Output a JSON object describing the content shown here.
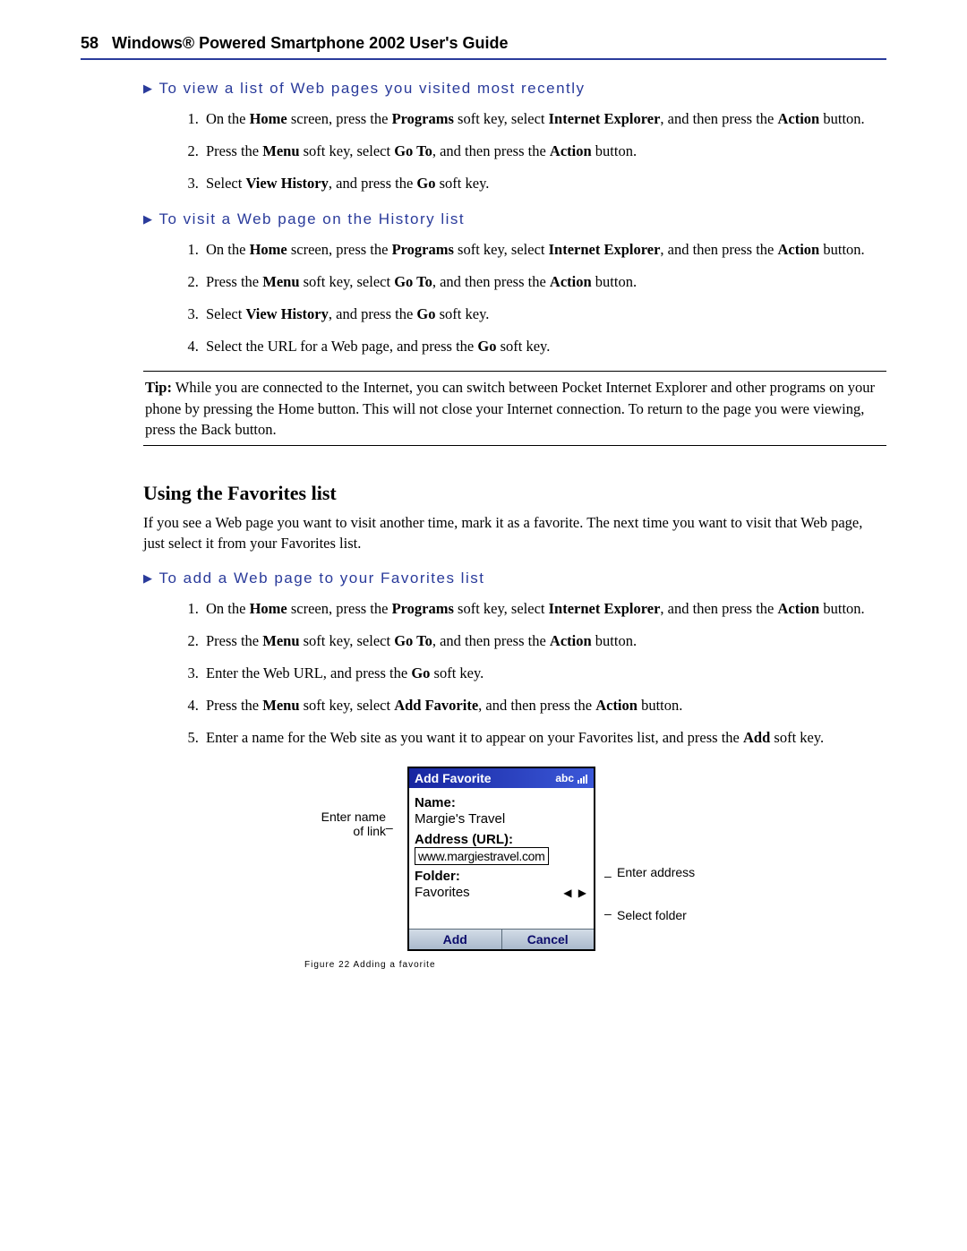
{
  "header": {
    "page_number": "58",
    "title": "Windows® Powered Smartphone 2002 User's Guide"
  },
  "section1": {
    "title": "To view a list of Web pages you visited most recently",
    "steps": {
      "s1a": "On the ",
      "s1b": "Home",
      "s1c": " screen, press the ",
      "s1d": "Programs",
      "s1e": " soft key, select ",
      "s1f": "Internet Explorer",
      "s1g": ", and then press the ",
      "s1h": "Action",
      "s1i": " button.",
      "s2a": "Press the ",
      "s2b": "Menu",
      "s2c": " soft key, select ",
      "s2d": "Go To",
      "s2e": ", and then press the ",
      "s2f": "Action",
      "s2g": " button.",
      "s3a": "Select ",
      "s3b": "View History",
      "s3c": ", and press the ",
      "s3d": "Go",
      "s3e": " soft key."
    }
  },
  "section2": {
    "title": "To visit a Web page on the History list",
    "steps": {
      "s1a": "On the ",
      "s1b": "Home",
      "s1c": " screen, press the ",
      "s1d": "Programs",
      "s1e": " soft key, select ",
      "s1f": "Internet Explorer",
      "s1g": ", and then press the ",
      "s1h": "Action",
      "s1i": " button.",
      "s2a": "Press the ",
      "s2b": "Menu",
      "s2c": " soft key, select ",
      "s2d": "Go To",
      "s2e": ", and then press the ",
      "s2f": "Action",
      "s2g": " button.",
      "s3a": "Select ",
      "s3b": "View History",
      "s3c": ", and press the ",
      "s3d": "Go",
      "s3e": " soft key.",
      "s4a": "Select the URL for a Web page, and press the ",
      "s4b": "Go",
      "s4c": " soft key."
    }
  },
  "tip": {
    "label": "Tip:",
    "text": "  While you are connected to the Internet, you can switch between Pocket Internet Explorer and other programs on your phone by pressing the Home button. This will not close your Internet connection. To return to the page you were viewing, press the Back button."
  },
  "favorites": {
    "heading": "Using the Favorites list",
    "intro": "If you see a Web page you want to visit another time, mark it as a favorite. The next time you want to visit that Web page, just select it from your Favorites list."
  },
  "section3": {
    "title": "To add a Web page to your Favorites list",
    "steps": {
      "s1a": "On the ",
      "s1b": "Home",
      "s1c": " screen, press the ",
      "s1d": "Programs",
      "s1e": " soft key, select ",
      "s1f": "Internet Explorer",
      "s1g": ", and then press the ",
      "s1h": "Action",
      "s1i": " button.",
      "s2a": "Press the ",
      "s2b": "Menu",
      "s2c": " soft key, select ",
      "s2d": "Go To",
      "s2e": ", and then press the ",
      "s2f": "Action",
      "s2g": " button.",
      "s3a": "Enter the Web URL, and press the ",
      "s3b": "Go",
      "s3c": " soft key.",
      "s4a": "Press the ",
      "s4b": "Menu",
      "s4c": " soft key, select ",
      "s4d": "Add Favorite",
      "s4e": ", and then press the ",
      "s4f": "Action",
      "s4g": " button.",
      "s5a": "Enter a name for the Web site as you want it to appear on your Favorites list, and press the ",
      "s5b": "Add",
      "s5c": " soft key."
    }
  },
  "phone": {
    "titlebar": "Add Favorite",
    "input_mode": "abc",
    "name_label": "Name:",
    "name_value": "Margie's Travel",
    "url_label": "Address (URL):",
    "url_value": "www.margiestravel.com",
    "folder_label": "Folder:",
    "folder_value": "Favorites",
    "sk_left": "Add",
    "sk_right": "Cancel"
  },
  "callouts": {
    "left1a": "Enter name",
    "left1b": "of link",
    "right1": "Enter address",
    "right2": "Select folder"
  },
  "figure_caption": "Figure 22 Adding a favorite"
}
